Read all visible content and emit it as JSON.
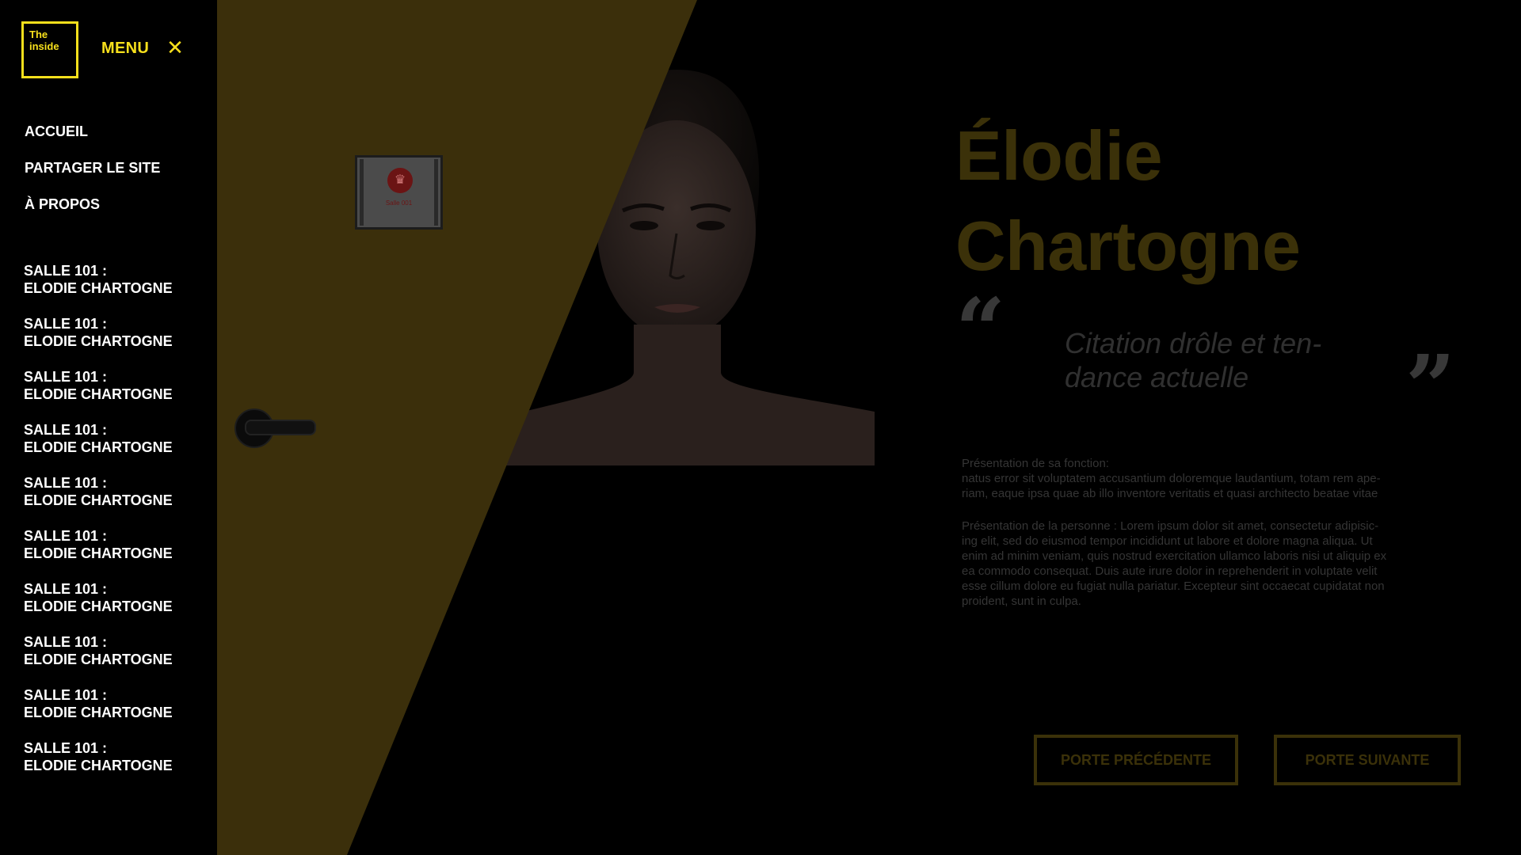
{
  "logo": {
    "line1": "The",
    "line2": "inside"
  },
  "menu": {
    "label": "MENU",
    "close_symbol": "✕"
  },
  "nav_main": [
    {
      "label": "ACCUEIL"
    },
    {
      "label": "PARTAGER LE SITE"
    },
    {
      "label": "À PROPOS"
    }
  ],
  "rooms": [
    {
      "line1": "SALLE 101 :",
      "line2": "ELODIE CHARTOGNE"
    },
    {
      "line1": "SALLE 101 :",
      "line2": "ELODIE CHARTOGNE"
    },
    {
      "line1": "SALLE 101 :",
      "line2": "ELODIE CHARTOGNE"
    },
    {
      "line1": "SALLE 101 :",
      "line2": "ELODIE CHARTOGNE"
    },
    {
      "line1": "SALLE 101 :",
      "line2": "ELODIE CHARTOGNE"
    },
    {
      "line1": "SALLE 101 :",
      "line2": "ELODIE CHARTOGNE"
    },
    {
      "line1": "SALLE 101 :",
      "line2": "ELODIE CHARTOGNE"
    },
    {
      "line1": "SALLE 101 :",
      "line2": "ELODIE CHARTOGNE"
    },
    {
      "line1": "SALLE 101 :",
      "line2": "ELODIE CHARTOGNE"
    },
    {
      "line1": "SALLE 101 :",
      "line2": "ELODIE CHARTOGNE"
    }
  ],
  "door": {
    "sign_text": "Salle 001",
    "sign_icon": "crown-icon"
  },
  "profile": {
    "name_line1": "Élodie",
    "name_line2": "Chartogne",
    "quote_open": "“",
    "quote_close": "”",
    "quote_line1": "Citation drôle et ten-",
    "quote_line2": "dance actuelle",
    "para1_line1": "Présentation de sa fonction:",
    "para1_line2": "natus error sit voluptatem accusantium doloremque laudantium, totam rem ape-",
    "para1_line3": "riam, eaque ipsa quae ab illo inventore veritatis et quasi architecto beatae vitae",
    "para2_line1": "Présentation de la personne : Lorem ipsum dolor sit amet, consectetur adipisic-",
    "para2_line2": "ing elit, sed do eiusmod tempor incididunt ut labore et dolore magna aliqua. Ut",
    "para2_line3": "enim ad minim veniam, quis nostrud exercitation ullamco laboris nisi ut aliquip ex",
    "para2_line4": "ea commodo consequat. Duis aute irure dolor in reprehenderit in voluptate velit",
    "para2_line5": "esse cillum dolore eu fugiat nulla pariatur. Excepteur sint occaecat cupidatat non",
    "para2_line6": "proident, sunt in culpa."
  },
  "buttons": {
    "prev": "PORTE PRÉCÉDENTE",
    "next": "PORTE SUIVANTE"
  },
  "colors": {
    "accent": "#f7e01c",
    "door": "#3b2f0b",
    "background": "#000000"
  }
}
